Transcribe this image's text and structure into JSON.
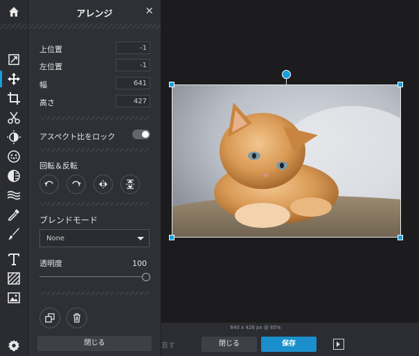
{
  "panel": {
    "title": "アレンジ",
    "close_icon": "×",
    "fields": [
      {
        "label": "上位置",
        "value": "-1"
      },
      {
        "label": "左位置",
        "value": "-1"
      },
      {
        "label": "幅",
        "value": "641"
      },
      {
        "label": "高さ",
        "value": "427"
      }
    ],
    "aspect_lock_label": "アスペクト比をロック",
    "aspect_lock_on": true,
    "rotate_flip_label": "回転＆反転",
    "blend_mode_label": "ブレンドモード",
    "blend_mode_value": "None",
    "opacity_label": "透明度",
    "opacity_value": "100",
    "close_label": "閉じる"
  },
  "status": {
    "info": "640 x 426 px @ 65%"
  },
  "bottombar": {
    "redo_label": "直す",
    "close_label": "閉じる",
    "save_label": "保存"
  },
  "colors": {
    "accent": "#18a0dc",
    "save": "#1b8fcb"
  },
  "icons": [
    "home-icon",
    "adjust-icon",
    "move-icon",
    "crop-icon",
    "cut-icon",
    "exposure-icon",
    "filter-icon",
    "vignette-icon",
    "wave-icon",
    "dropper-icon",
    "brush-icon",
    "text-icon",
    "texture-icon",
    "image-icon",
    "settings-icon"
  ]
}
